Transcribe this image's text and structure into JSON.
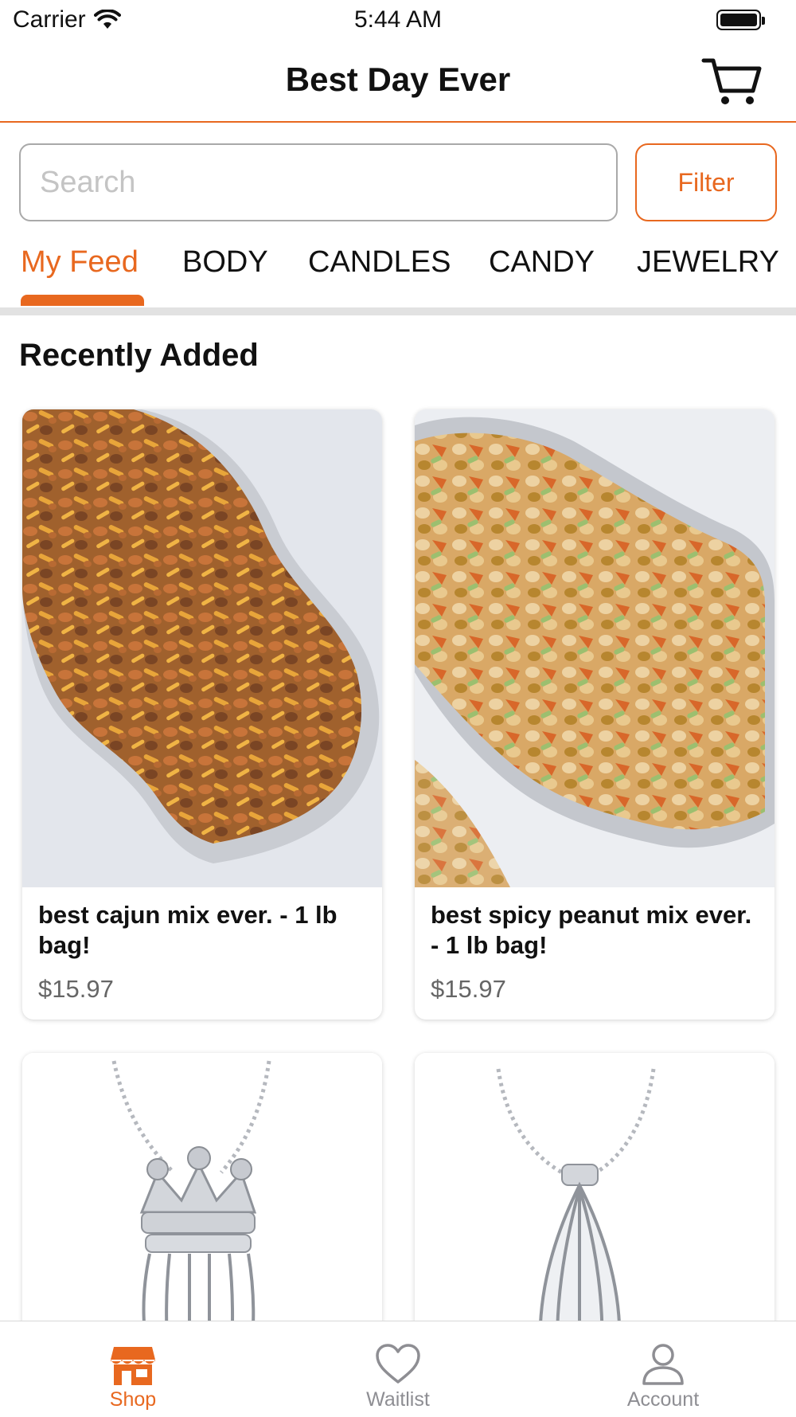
{
  "status_bar": {
    "carrier": "Carrier",
    "time": "5:44 AM"
  },
  "nav": {
    "title": "Best Day Ever",
    "cart_icon": "shopping-cart-icon"
  },
  "search": {
    "placeholder": "Search",
    "value": ""
  },
  "filter": {
    "label": "Filter"
  },
  "tabs": [
    {
      "label": "My Feed",
      "active": true
    },
    {
      "label": "BODY",
      "active": false
    },
    {
      "label": "CANDLES",
      "active": false
    },
    {
      "label": "CANDY",
      "active": false
    },
    {
      "label": "JEWELRY",
      "active": false
    }
  ],
  "section": {
    "title": "Recently Added"
  },
  "products": [
    {
      "name": "best cajun mix ever. - 1 lb bag!",
      "price": "$15.97",
      "image": "cajun-snack-mix-photo"
    },
    {
      "name": "best spicy peanut mix ever. - 1 lb bag!",
      "price": "$15.97",
      "image": "spicy-peanut-mix-photo"
    },
    {
      "image": "crown-locket-necklace-photo"
    },
    {
      "image": "cage-locket-necklace-photo"
    }
  ],
  "tab_bar": [
    {
      "label": "Shop",
      "icon": "shop-icon",
      "active": true
    },
    {
      "label": "Waitlist",
      "icon": "heart-icon",
      "active": false
    },
    {
      "label": "Account",
      "icon": "person-icon",
      "active": false
    }
  ],
  "colors": {
    "accent": "#e8681f",
    "inactive": "#8e8e93",
    "divider": "#e2e2e2"
  }
}
